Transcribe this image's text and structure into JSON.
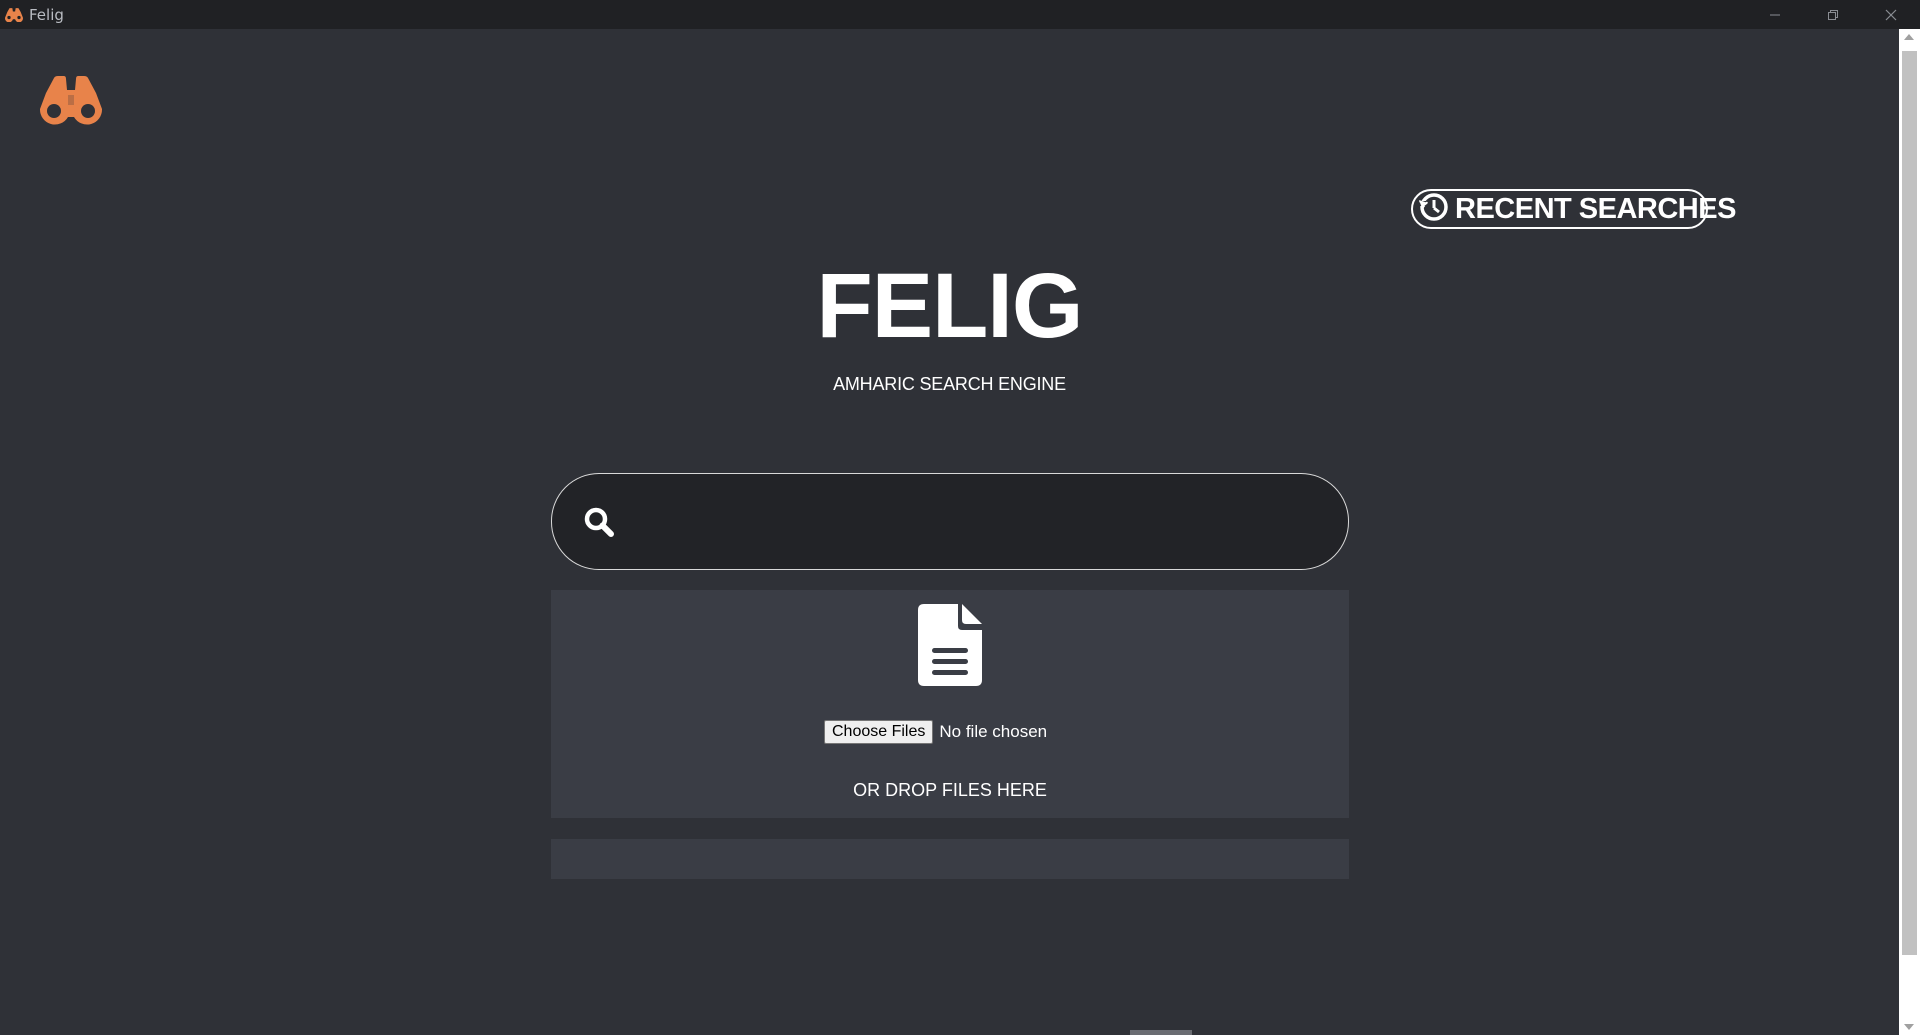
{
  "window": {
    "title": "Felig",
    "controls": [
      "minimize",
      "restore",
      "close"
    ]
  },
  "app": {
    "brand": "FELIG",
    "subtitle": "AMHARIC SEARCH ENGINE",
    "logo_icon": "binoculars-icon",
    "accent_color": "#e8834a"
  },
  "header": {
    "recent_searches_label": "RECENT SEARCHES",
    "recent_icon": "history-icon"
  },
  "search": {
    "value": "",
    "placeholder": "",
    "icon": "search-icon"
  },
  "upload": {
    "icon": "file-document-icon",
    "choose_label": "Choose Files",
    "status": "No file chosen",
    "drop_text": "OR DROP FILES HERE"
  }
}
